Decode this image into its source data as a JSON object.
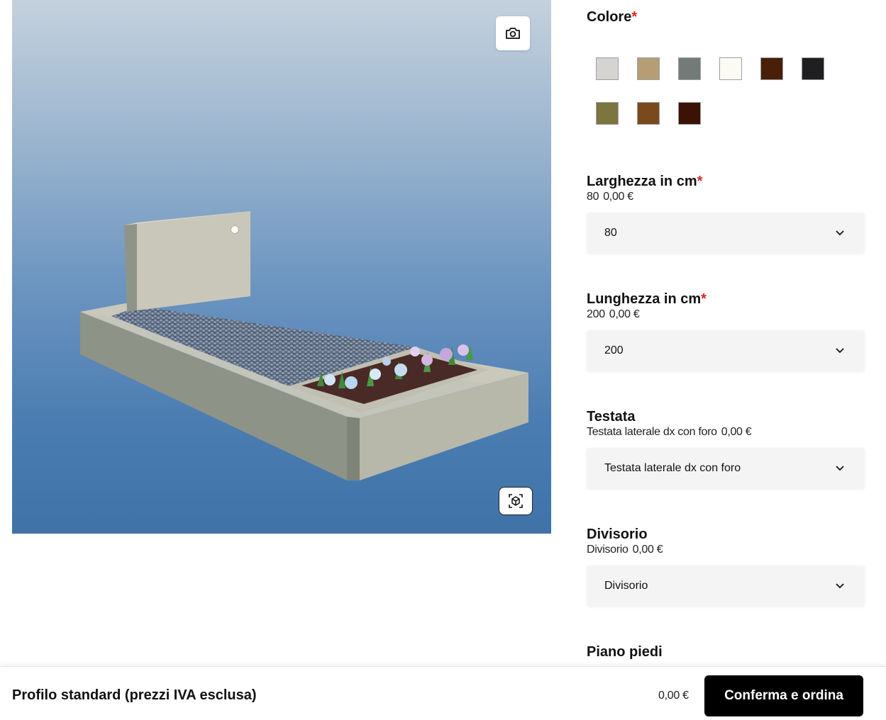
{
  "viewer": {
    "camera_icon": "camera-icon",
    "ar_icon": "ar-cube-icon"
  },
  "colore": {
    "title": "Colore",
    "required_mark": "*",
    "swatches": [
      "#d6d4d0",
      "#b59e74",
      "#737b79",
      "#fbfbf3",
      "#4a1f08",
      "#1f1f21",
      "#7d7540",
      "#7a4a1d",
      "#3c1204"
    ]
  },
  "larghezza": {
    "title": "Larghezza in cm",
    "required_mark": "*",
    "sub_value": "80",
    "sub_price": "0,00 €",
    "selected": "80"
  },
  "lunghezza": {
    "title": "Lunghezza in cm",
    "required_mark": "*",
    "sub_value": "200",
    "sub_price": "0,00 €",
    "selected": "200"
  },
  "testata": {
    "title": "Testata",
    "sub_value": "Testata laterale dx con foro",
    "sub_price": "0,00 €",
    "selected": "Testata laterale dx con foro"
  },
  "divisorio": {
    "title": "Divisorio",
    "sub_value": "Divisorio",
    "sub_price": "0,00 €",
    "selected": "Divisorio"
  },
  "piano_piedi": {
    "title": "Piano piedi"
  },
  "footer": {
    "profile": "Profilo standard (prezzi IVA esclusa)",
    "total": "0,00 €",
    "cta": "Conferma e ordina"
  }
}
